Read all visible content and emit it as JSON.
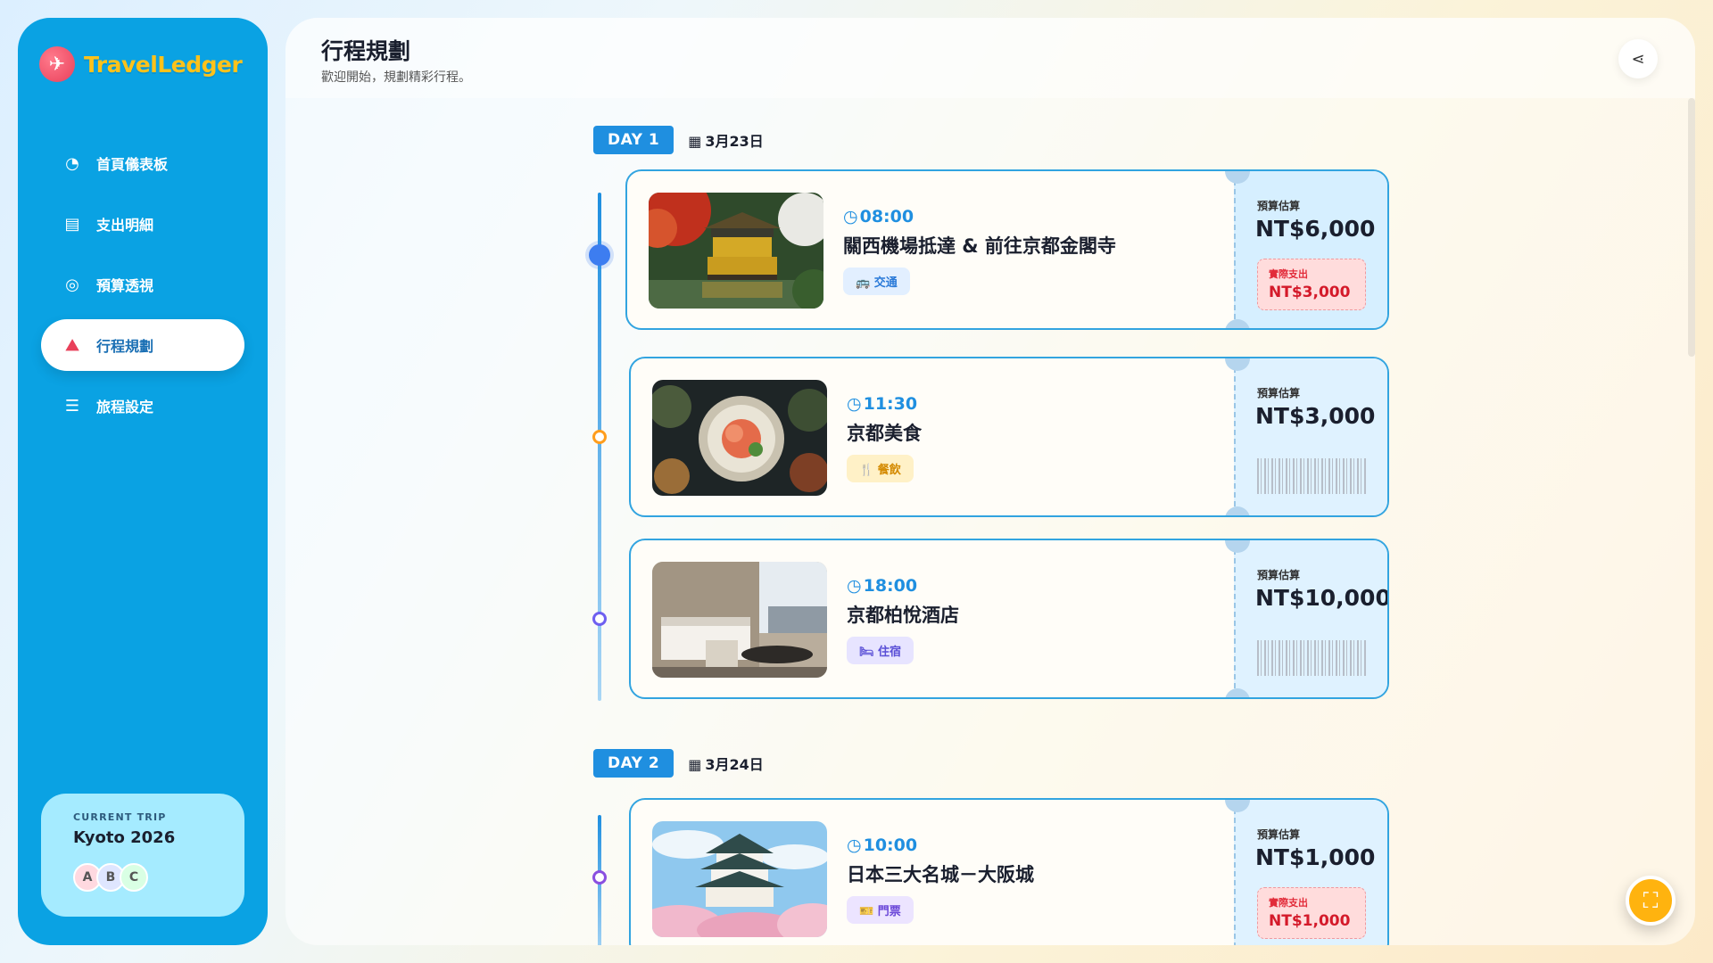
{
  "brand": {
    "name": "TravelLedger",
    "logo_glyph": "✈"
  },
  "sidebar": {
    "items": [
      {
        "label": "首頁儀表板",
        "icon": "◔",
        "active": false
      },
      {
        "label": "支出明細",
        "icon": "▤",
        "active": false
      },
      {
        "label": "預算透視",
        "icon": "◎",
        "active": false
      },
      {
        "label": "行程規劃",
        "icon": "⛰",
        "active": true
      },
      {
        "label": "旅程設定",
        "icon": "☰",
        "active": false
      }
    ],
    "trip": {
      "label": "CURRENT TRIP",
      "name": "Kyoto 2026",
      "avatars": [
        "A",
        "B",
        "C"
      ]
    }
  },
  "header": {
    "title": "行程規劃",
    "subtitle": "歡迎開始，規劃精彩行程。",
    "share_icon": "share-icon"
  },
  "days": [
    {
      "tag": "DAY 1",
      "date": "3月23日",
      "items": [
        {
          "time": "08:00",
          "title": "關西機場抵達 & 前往京都金閣寺",
          "category": "交通",
          "category_icon": "🚌",
          "budget_label": "預算估算",
          "budget": "NT$6,000",
          "actual_label": "實際支出",
          "actual": "NT$3,000"
        },
        {
          "time": "11:30",
          "title": "京都美食",
          "category": "餐飲",
          "category_icon": "🍴",
          "budget_label": "預算估算",
          "budget": "NT$3,000"
        },
        {
          "time": "18:00",
          "title": "京都柏悅酒店",
          "category": "住宿",
          "category_icon": "🛏",
          "budget_label": "預算估算",
          "budget": "NT$10,000"
        }
      ]
    },
    {
      "tag": "DAY 2",
      "date": "3月24日",
      "items": [
        {
          "time": "10:00",
          "title": "日本三大名城－大阪城",
          "category": "門票",
          "category_icon": "🎫",
          "budget_label": "預算估算",
          "budget": "NT$1,000",
          "actual_label": "實際支出",
          "actual": "NT$1,000"
        }
      ]
    }
  ],
  "colors": {
    "primary": "#0aa2e3",
    "accent": "#1f8fe0",
    "brand": "#ffc21a",
    "danger": "#e22c3a",
    "fab": "#ffb30f"
  },
  "fab_icon": "map-icon"
}
